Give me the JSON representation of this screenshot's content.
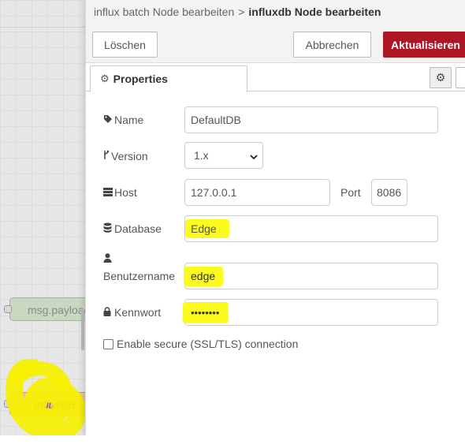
{
  "breadcrumb": {
    "parent": "influx batch Node bearbeiten",
    "separator": ">",
    "current": "influxdb Node bearbeiten"
  },
  "buttons": {
    "delete": "Löschen",
    "cancel": "Abbrechen",
    "update": "Aktualisieren"
  },
  "tabs": {
    "properties": "Properties"
  },
  "form": {
    "name": {
      "label": "Name",
      "value": "DefaultDB"
    },
    "version": {
      "label": "Version",
      "value": "1.x"
    },
    "host": {
      "label": "Host",
      "value": "127.0.0.1"
    },
    "port": {
      "label": "Port",
      "value": "8086"
    },
    "database": {
      "label": "Database",
      "value": "Edge"
    },
    "username": {
      "label": "Benutzername",
      "value": "edge"
    },
    "password": {
      "label": "Kennwort",
      "value": "••••••••"
    },
    "ssl": {
      "label": "Enable secure (SSL/TLS) connection",
      "checked": false
    }
  },
  "canvas": {
    "nodes": [
      "msg.payload",
      "InfluxDB"
    ]
  },
  "colors": {
    "accent": "#ad1625",
    "highlight": "#fbfb1f"
  },
  "icons": [
    "gear-icon",
    "tag-icon",
    "branch-icon",
    "server-icon",
    "database-icon",
    "user-icon",
    "lock-icon",
    "chevron-down-icon"
  ]
}
